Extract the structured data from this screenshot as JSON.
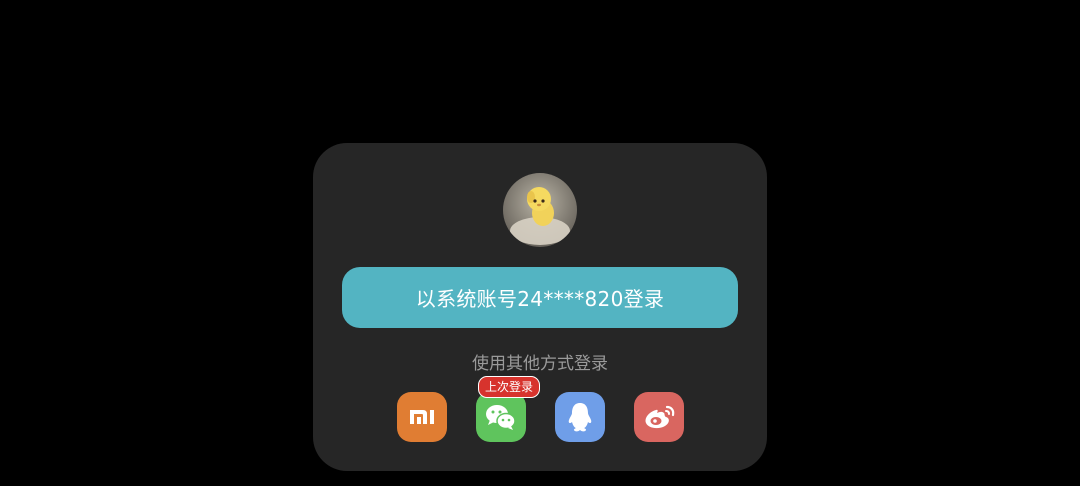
{
  "dialog": {
    "avatar": {
      "name": "avatar"
    },
    "login_button": {
      "label": "以系统账号24****820登录"
    },
    "other_methods_label": "使用其他方式登录",
    "providers": [
      {
        "name": "xiaomi",
        "icon": "xiaomi-icon",
        "color": "#e07d33"
      },
      {
        "name": "wechat",
        "icon": "wechat-icon",
        "color": "#5fc45d"
      },
      {
        "name": "qq",
        "icon": "qq-icon",
        "color": "#6f9ee8"
      },
      {
        "name": "weibo",
        "icon": "weibo-icon",
        "color": "#d96660"
      }
    ],
    "last_login_badge": "上次登录"
  },
  "colors": {
    "background": "#000000",
    "dialog": "#262626",
    "primary_button": "#53b4c2",
    "badge": "#d7332d"
  }
}
